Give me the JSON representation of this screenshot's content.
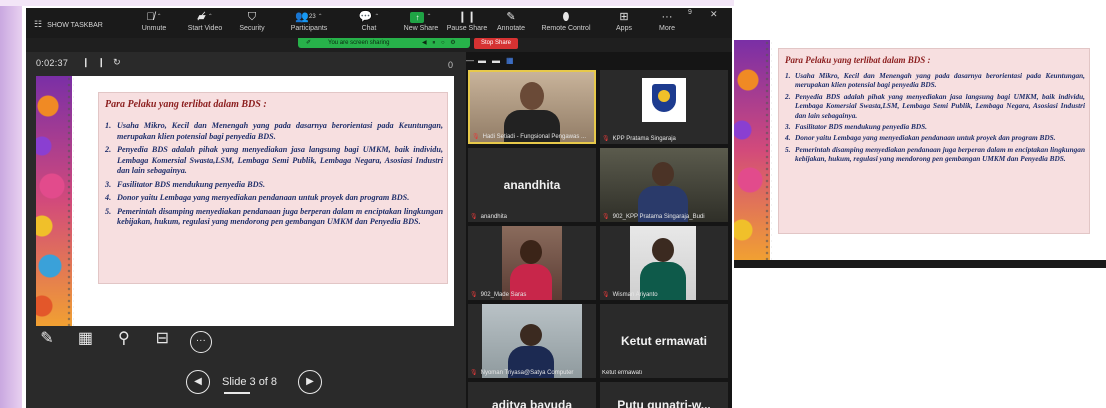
{
  "toolbar": {
    "show_taskbar": "SHOW TASKBAR",
    "unmute": "Unmute",
    "start_video": "Start Video",
    "security": "Security",
    "participants": "Participants",
    "participants_count": "23",
    "chat": "Chat",
    "new_share": "New Share",
    "pause_share": "Pause Share",
    "annotate": "Annotate",
    "remote_control": "Remote Control",
    "apps": "Apps",
    "more": "More",
    "badge": "9"
  },
  "sharing": {
    "banner": "You are screen sharing",
    "stop": "Stop Share"
  },
  "presentation": {
    "timer": "0:02:37",
    "slide_label": "Slide 3 of 8"
  },
  "slide": {
    "title": "Para Pelaku yang terlibat dalam BDS :",
    "items": [
      {
        "num": "1.",
        "text": "Usaha Mikro, Kecil dan Menengah yang pada dasarnya berorientasi pada Keuntungan, merupakan klien potensial bagi penyedia BDS."
      },
      {
        "num": "2.",
        "text": "Penyedia BDS adalah pihak yang menyediakan jasa langsung bagi UMKM, baik individu, Lembaga Komersial Swasta,LSM, Lembaga Semi Publik, Lembaga Negara, Asosiasi Industri dan lain sebagainya."
      },
      {
        "num": "3.",
        "text": "Fasilitator BDS mendukung penyedia BDS."
      },
      {
        "num": "4.",
        "text": "Donor yaitu Lembaga yang menyediakan pendanaan untuk proyek dan program BDS."
      },
      {
        "num": "5.",
        "text": "Pemerintah disamping menyediakan pendanaan juga berperan dalam m enciptakan lingkungan kebijakan, hukum, regulasi yang mendorong pen gembangan UMKM dan Penyedia BDS."
      }
    ]
  },
  "participants": [
    {
      "name": "Hadi Setiadi - Fungsional Pengawas ...",
      "muted": true,
      "video": "person",
      "active": true
    },
    {
      "name": "KPP Pratama Singaraja",
      "muted": true,
      "video": "logo"
    },
    {
      "name": "anandhita",
      "muted": true,
      "video": "none",
      "big": "anandhita"
    },
    {
      "name": "902_KPP Pratama Singaraja_Budi",
      "muted": true,
      "video": "person"
    },
    {
      "name": "902_Made Saras",
      "muted": true,
      "video": "person"
    },
    {
      "name": "Wisman Ariyanto",
      "muted": true,
      "video": "person"
    },
    {
      "name": "Nyoman Triyasa@Satya Computer",
      "muted": true,
      "video": "person"
    },
    {
      "name": "Ketut ermawati",
      "muted": false,
      "video": "none",
      "big": "Ketut ermawati"
    },
    {
      "name": "",
      "muted": false,
      "video": "none",
      "big": "aditya bayuda"
    },
    {
      "name": "",
      "muted": false,
      "video": "none",
      "big": "Putu gunatri-w..."
    }
  ]
}
